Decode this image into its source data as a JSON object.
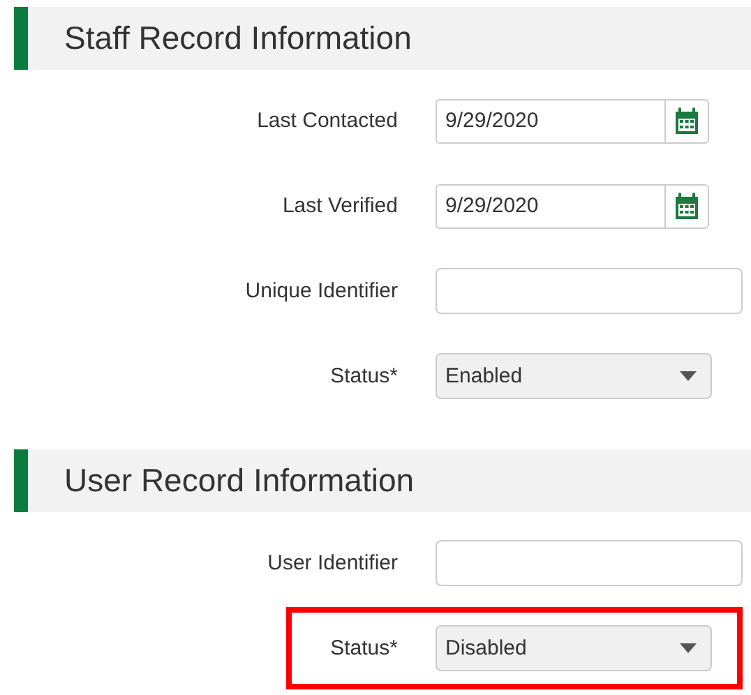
{
  "sections": [
    {
      "title": "Staff Record Information",
      "fields": [
        {
          "kind": "date",
          "label": "Last Contacted",
          "value": "9/29/2020",
          "highlighted": false
        },
        {
          "kind": "date",
          "label": "Last Verified",
          "value": "9/29/2020",
          "highlighted": false
        },
        {
          "kind": "text",
          "label": "Unique Identifier",
          "highlighted": false
        },
        {
          "kind": "select",
          "label": "Status*",
          "value": "Enabled",
          "highlighted": false
        }
      ]
    },
    {
      "title": "User Record Information",
      "fields": [
        {
          "kind": "text",
          "label": "User Identifier",
          "highlighted": false
        },
        {
          "kind": "select",
          "label": "Status*",
          "value": "Disabled",
          "highlighted": true
        }
      ]
    }
  ]
}
